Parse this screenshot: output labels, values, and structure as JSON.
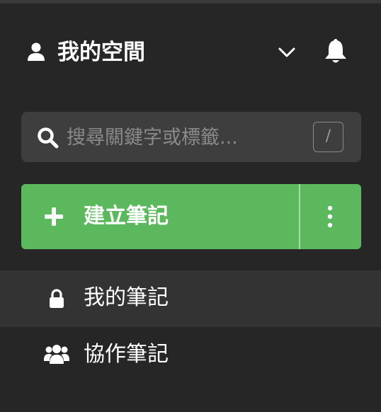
{
  "header": {
    "workspace_title": "我的空間",
    "workspace_icon": "user-icon",
    "dropdown_icon": "chevron-down-icon",
    "notification_icon": "bell-icon"
  },
  "search": {
    "placeholder": "搜尋關鍵字或標籤...",
    "value": "",
    "shortcut_key": "/",
    "icon": "search-icon"
  },
  "create": {
    "label": "建立筆記",
    "icon": "plus-icon",
    "more_icon": "vertical-ellipsis-icon"
  },
  "nav": {
    "items": [
      {
        "label": "我的筆記",
        "icon": "lock-icon",
        "active": true
      },
      {
        "label": "協作筆記",
        "icon": "users-icon",
        "active": false
      }
    ]
  },
  "colors": {
    "background": "#262626",
    "active_row": "#333333",
    "search_bg": "#3e3e3e",
    "accent_green": "#5cb85c",
    "text": "#ffffff",
    "muted_text": "#8a8a8a"
  }
}
